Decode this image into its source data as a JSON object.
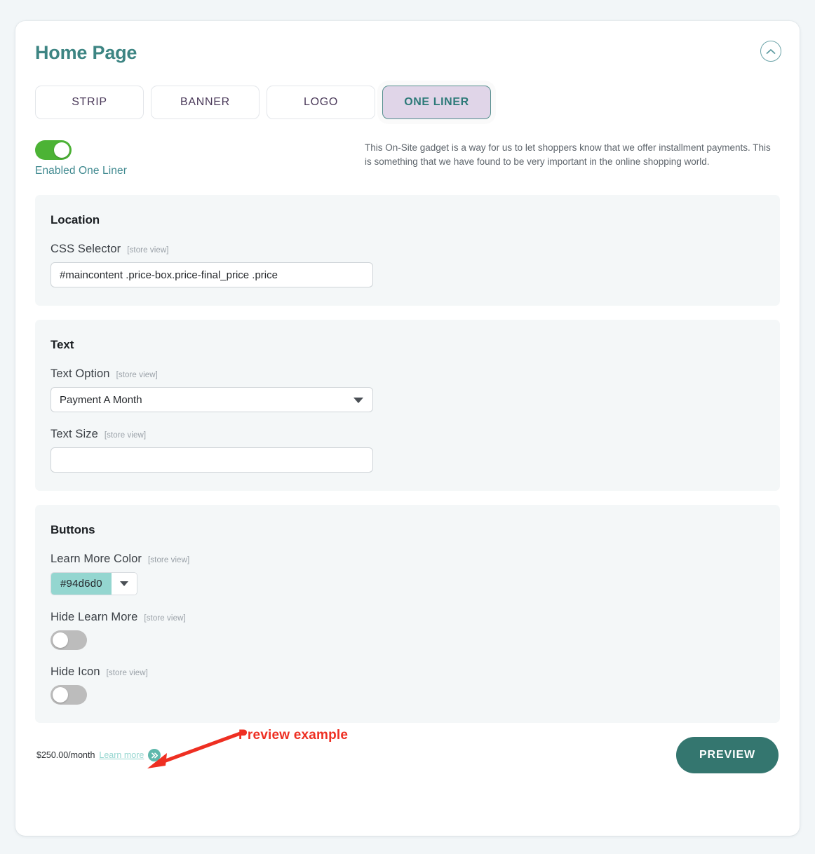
{
  "header": {
    "title": "Home Page",
    "collapse_icon": "chevron-up-circle-icon"
  },
  "tabs": [
    {
      "label": "STRIP",
      "active": false
    },
    {
      "label": "BANNER",
      "active": false
    },
    {
      "label": "LOGO",
      "active": false
    },
    {
      "label": "ONE LINER",
      "active": true
    }
  ],
  "enable": {
    "toggle_state": "on",
    "label": "Enabled One Liner",
    "description": "This On-Site gadget is a way for us to let shoppers know that we offer installment payments. This is something that we have found to be very important in the online shopping world."
  },
  "sections": {
    "location": {
      "title": "Location",
      "css_selector": {
        "label": "CSS Selector",
        "scope": "[store view]",
        "value": "#maincontent .price-box.price-final_price .price",
        "placeholder": ""
      }
    },
    "text": {
      "title": "Text",
      "text_option": {
        "label": "Text Option",
        "scope": "[store view]",
        "value": "Payment A Month",
        "options": [
          "Payment A Month"
        ],
        "caret_icon": "chevron-down-icon"
      },
      "text_size": {
        "label": "Text Size",
        "scope": "[store view]",
        "value": "",
        "placeholder": ""
      }
    },
    "buttons": {
      "title": "Buttons",
      "learn_more_color": {
        "label": "Learn More Color",
        "scope": "[store view]",
        "value": "#94d6d0",
        "swatch_color": "#94d6d0",
        "caret_icon": "chevron-down-icon"
      },
      "hide_learn_more": {
        "label": "Hide Learn More",
        "scope": "[store view]",
        "toggle_state": "off"
      },
      "hide_icon": {
        "label": "Hide Icon",
        "scope": "[store view]",
        "toggle_state": "off"
      }
    }
  },
  "preview": {
    "price_text": "$250.00/month",
    "learn_more_label": "Learn more",
    "chevron_icon": "double-chevron-right-icon",
    "button_label": "PREVIEW"
  },
  "annotation": {
    "text": "Preview example",
    "color": "#ee2f22",
    "arrow_icon": "arrow-down-left-icon"
  },
  "colors": {
    "title_teal": "#3d8583",
    "active_tab_bg": "#e0d5e8",
    "active_tab_text": "#2d7a78",
    "toggle_on_green": "#4cb335",
    "panel_bg": "#f4f7f8",
    "preview_button_bg": "#34766f",
    "page_bg": "#f2f6f8"
  }
}
